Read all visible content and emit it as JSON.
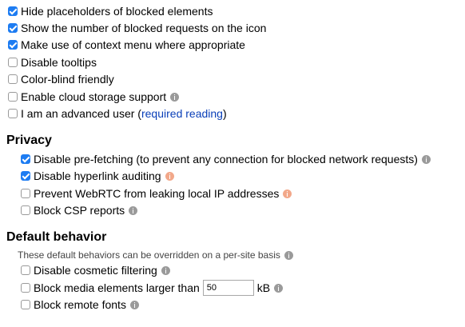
{
  "general": {
    "items": [
      {
        "label": "Hide placeholders of blocked elements",
        "checked": true,
        "info": false
      },
      {
        "label": "Show the number of blocked requests on the icon",
        "checked": true,
        "info": false
      },
      {
        "label": "Make use of context menu where appropriate",
        "checked": true,
        "info": false
      },
      {
        "label": "Disable tooltips",
        "checked": false,
        "info": false
      },
      {
        "label": "Color-blind friendly",
        "checked": false,
        "info": false
      },
      {
        "label": "Enable cloud storage support",
        "checked": false,
        "info": true,
        "info_icon": "info-icon"
      }
    ],
    "advanced": {
      "label_prefix": "I am an advanced user (",
      "link": "required reading",
      "label_suffix": ")",
      "checked": false
    }
  },
  "privacy": {
    "title": "Privacy",
    "items": [
      {
        "label": "Disable pre-fetching (to prevent any connection for blocked network requests)",
        "checked": true,
        "info_icon": "info-icon"
      },
      {
        "label": "Disable hyperlink auditing",
        "checked": true,
        "info_icon": "warning-info-icon"
      },
      {
        "label": "Prevent WebRTC from leaking local IP addresses",
        "checked": false,
        "info_icon": "warning-info-icon"
      },
      {
        "label": "Block CSP reports",
        "checked": false,
        "info_icon": "info-icon"
      }
    ]
  },
  "default_behavior": {
    "title": "Default behavior",
    "note": "These default behaviors can be overridden on a per-site basis",
    "items": [
      {
        "label": "Disable cosmetic filtering",
        "checked": false,
        "info_icon": "info-icon"
      },
      {
        "label": "Block media elements larger than",
        "checked": false,
        "value": "50",
        "unit": "kB",
        "info_icon": "info-icon"
      },
      {
        "label": "Block remote fonts",
        "checked": false,
        "info_icon": "info-icon"
      }
    ]
  },
  "colors": {
    "checkbox_checked": "#1d7cf2",
    "info_icon": "#9a9a9a",
    "warning_info_icon": "#f2a88a",
    "link": "#0a3fb8"
  }
}
